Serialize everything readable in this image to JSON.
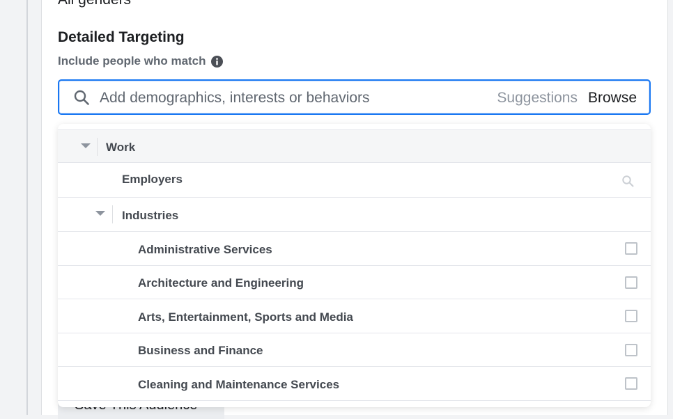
{
  "audience": {
    "gender_value": "All genders"
  },
  "detailed_targeting": {
    "title": "Detailed Targeting",
    "subtitle": "Include people who match",
    "search": {
      "placeholder": "Add demographics, interests or behaviors",
      "value": ""
    },
    "suggestions_label": "Suggestions",
    "browse_label": "Browse"
  },
  "browse_tree": {
    "root": {
      "label": "Work",
      "expanded": true
    },
    "employers": {
      "label": "Employers"
    },
    "industries": {
      "label": "Industries",
      "expanded": true
    },
    "industry_items": [
      {
        "label": "Administrative Services",
        "checked": false
      },
      {
        "label": "Architecture and Engineering",
        "checked": false
      },
      {
        "label": "Arts, Entertainment, Sports and Media",
        "checked": false
      },
      {
        "label": "Business and Finance",
        "checked": false
      },
      {
        "label": "Cleaning and Maintenance Services",
        "checked": false
      }
    ]
  },
  "footer": {
    "save_audience_label": "Save This Audience"
  },
  "colors": {
    "accent_blue": "#1877f2",
    "text_primary": "#1c1e21",
    "text_secondary": "#606770",
    "row_header_bg": "#f5f6f7",
    "divider": "#e4e6eb"
  },
  "icons": {
    "search": "search-icon",
    "info": "info-icon",
    "caret": "caret-down-icon",
    "checkbox": "checkbox-icon"
  }
}
